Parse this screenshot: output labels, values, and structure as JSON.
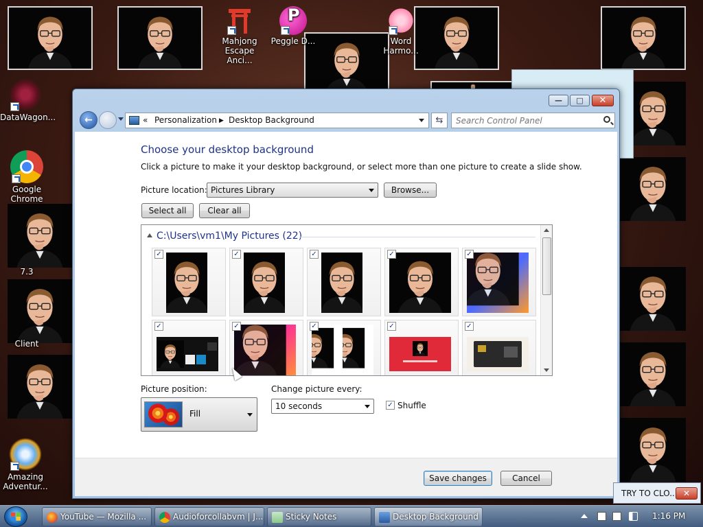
{
  "desktop": {
    "icons": [
      {
        "label": "Mahjong Escape Anci...",
        "icon": "mahjong-gate-icon"
      },
      {
        "label": "Peggle D...",
        "icon": "peggle-icon"
      },
      {
        "label": "Word Harmo...",
        "icon": "flower-icon"
      },
      {
        "label": "DataWagon...",
        "icon": "datawagon-icon"
      },
      {
        "label": "Google Chrome",
        "icon": "chrome-icon"
      },
      {
        "label": "7.3",
        "icon": "app-icon"
      },
      {
        "label": "Client",
        "icon": "app-icon"
      },
      {
        "label": "Amazing Adventur...",
        "icon": "diamond-icon"
      }
    ]
  },
  "window": {
    "breadcrumb": {
      "prefix": "«",
      "items": [
        "Personalization",
        "Desktop Background"
      ]
    },
    "search": {
      "placeholder": "Search Control Panel"
    },
    "controls": {
      "min": "—",
      "max": "□",
      "close": "✕"
    }
  },
  "page": {
    "title": "Choose your desktop background",
    "subtitle": "Click a picture to make it your desktop background, or select more than one picture to create a slide show.",
    "picture_location_label": "Picture location:",
    "picture_location_value": "Pictures Library",
    "browse_label": "Browse...",
    "select_all_label": "Select all",
    "clear_all_label": "Clear all",
    "gallery_header": "C:\\Users\\vm1\\My Pictures (22)",
    "picture_position_label": "Picture position:",
    "picture_position_value": "Fill",
    "change_every_label": "Change picture every:",
    "change_every_value": "10 seconds",
    "shuffle_label": "Shuffle",
    "shuffle_checked": true,
    "save_label": "Save changes",
    "cancel_label": "Cancel",
    "checkmark": "✓"
  },
  "taskbar": {
    "buttons": [
      {
        "label": "YouTube — Mozilla ...",
        "icon": "firefox-icon"
      },
      {
        "label": "Audioforcollabvm | J...",
        "icon": "chrome-icon"
      },
      {
        "label": "Sticky Notes",
        "icon": "sticky-notes-icon"
      },
      {
        "label": "Desktop Background",
        "icon": "control-panel-icon"
      }
    ],
    "clock": "1:16 PM"
  },
  "notification": {
    "text": "TRY TO CLO...",
    "close": "✕"
  }
}
